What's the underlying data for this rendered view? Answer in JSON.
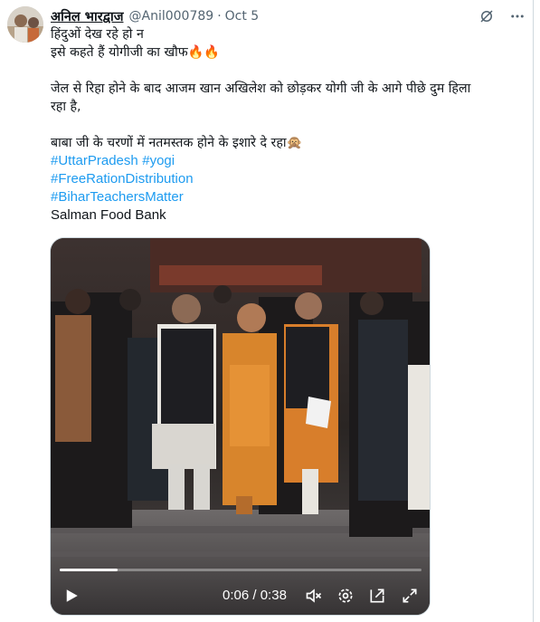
{
  "tweet": {
    "author_name": "अनिल भारद्वाज",
    "handle": "@Anil000789",
    "separator": "·",
    "date": "Oct 5",
    "lines": [
      "हिंदुओं देख रहे हो न",
      "इसे कहते हैं योगीजी का खौफ🔥🔥",
      "जेल से रिहा होने के बाद आजम खान अखिलेश को छोड़कर योगी जी के आगे पीछे दुम हिला",
      "रहा है,",
      "बाबा जी के चरणों में नतमस्तक होने के इशारे दे रहा🙊"
    ],
    "hashtags": [
      "#UttarPradesh",
      "#yogi",
      "#FreeRationDistribution",
      "#BiharTeachersMatter"
    ],
    "trailing_text": "Salman Food Bank"
  },
  "video": {
    "current_time": "0:06",
    "separator": "/",
    "duration": "0:38",
    "progress_fraction": 0.16
  },
  "icons": {
    "header": [
      "grok-icon",
      "more-icon"
    ],
    "controls": [
      "play-icon",
      "mute-icon",
      "settings-icon",
      "picture-in-picture-icon",
      "fullscreen-icon"
    ]
  },
  "colors": {
    "link": "#1d9bf0",
    "text": "#0f1419",
    "secondary": "#536471",
    "border": "#cfd9de"
  }
}
